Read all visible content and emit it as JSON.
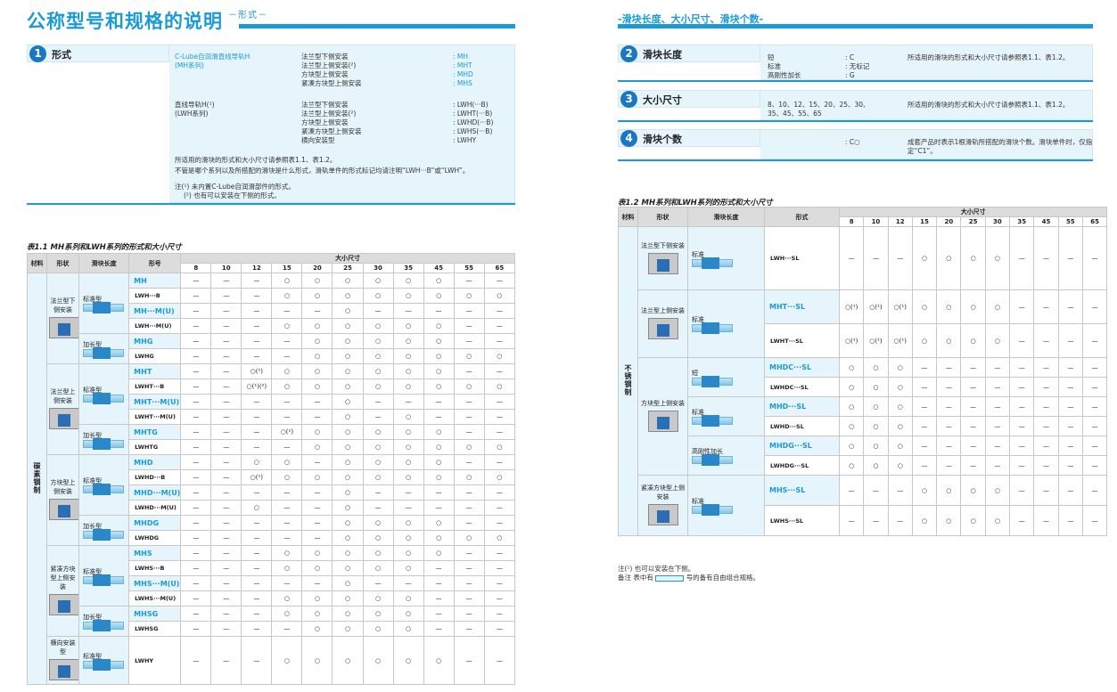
{
  "header": {
    "title": "公称型号和规格的说明",
    "subtitle": "－形式－",
    "right_title": "-滑块长度、大小尺寸、滑块个数-"
  },
  "section1": {
    "num": "1",
    "label": "形式",
    "group1": {
      "name_line1": "C-Lube自润滑直线导轨H",
      "name_line2": "(MH系列)",
      "items": [
        {
          "t": "法兰型下侧安装",
          "c": ": MH"
        },
        {
          "t": "法兰型上侧安装(²)",
          "c": ": MHT"
        },
        {
          "t": "方块型上侧安装",
          "c": ": MHD"
        },
        {
          "t": "紧凑方块型上侧安装",
          "c": ": MHS"
        }
      ]
    },
    "group2": {
      "name_line1": "直线导轨H(¹)",
      "name_line2": "(LWH系列)",
      "items": [
        {
          "t": "法兰型下侧安装",
          "c": ": LWH(···B)"
        },
        {
          "t": "法兰型上侧安装(²)",
          "c": ": LWHT(···B)"
        },
        {
          "t": "方块型上侧安装",
          "c": ": LWHD(···B)"
        },
        {
          "t": "紧凑方块型上侧安装",
          "c": ": LWHS(···B)"
        },
        {
          "t": "横向安装型",
          "c": ": LWHY"
        }
      ]
    },
    "note1": "所适用的滑块的形式和大小尺寸请参照表1.1、表1.2。",
    "note2": "不管是哪个系列以及所搭配的滑块是什么形式，滑轨单件的形式标记均请注明“LWH···B”或“LWH”。",
    "foot1": "注(¹) 未内置C-Lube自润滑部件的形式。",
    "foot2": "(²) 也有可以安装在下侧的形式。"
  },
  "section2": {
    "num": "2",
    "label": "滑块长度",
    "items": [
      {
        "t": "短",
        "c": ": C"
      },
      {
        "t": "标准",
        "c": ": 无标记"
      },
      {
        "t": "高刚性加长",
        "c": ": G"
      }
    ],
    "note": "所适用的滑块的形式和大小尺寸请参照表1.1、表1.2。"
  },
  "section3": {
    "num": "3",
    "label": "大小尺寸",
    "line1": "8、10、12、15、20、25、30、",
    "line2": "35、45、55、65",
    "note": "所适用的滑块的形式和大小尺寸请参照表1.1、表1.2。"
  },
  "section4": {
    "num": "4",
    "label": "滑块个数",
    "code": ": C○",
    "note_line1": "成套产品时表示1根滑轨所搭配的滑块个数。滑块单件时，仅指",
    "note_line2": "定“C1”。"
  },
  "table1": {
    "title": "表1.1  MH系列和LWH系列的形式和大小尺寸",
    "headers": {
      "material": "材料",
      "shape": "形状",
      "length": "滑块长度",
      "model": "形号",
      "size": "大小尺寸"
    },
    "sizes": [
      "8",
      "10",
      "12",
      "15",
      "20",
      "25",
      "30",
      "35",
      "45",
      "55",
      "65"
    ],
    "material": "碳素钢制",
    "groups": [
      {
        "shape": "法兰型下侧安装",
        "lengths": [
          {
            "len": "标准型",
            "rows": [
              {
                "model": "MH",
                "blue": true,
                "v": [
                  "—",
                  "—",
                  "—",
                  "○",
                  "○",
                  "○",
                  "○",
                  "○",
                  "○",
                  "—",
                  "—"
                ]
              },
              {
                "model": "LWH···B",
                "blue": false,
                "v": [
                  "—",
                  "—",
                  "—",
                  "○",
                  "○",
                  "○",
                  "○",
                  "○",
                  "○",
                  "○",
                  "○"
                ]
              },
              {
                "model": "MH···M(U)",
                "blue": true,
                "v": [
                  "—",
                  "—",
                  "—",
                  "—",
                  "—",
                  "○",
                  "—",
                  "—",
                  "—",
                  "—",
                  "—"
                ]
              },
              {
                "model": "LWH···M(U)",
                "blue": false,
                "v": [
                  "—",
                  "—",
                  "—",
                  "○",
                  "○",
                  "○",
                  "○",
                  "○",
                  "○",
                  "—",
                  "—"
                ]
              }
            ]
          },
          {
            "len": "加长型",
            "rows": [
              {
                "model": "MHG",
                "blue": true,
                "v": [
                  "—",
                  "—",
                  "—",
                  "—",
                  "○",
                  "○",
                  "○",
                  "○",
                  "○",
                  "—",
                  "—"
                ]
              },
              {
                "model": "LWHG",
                "blue": false,
                "v": [
                  "—",
                  "—",
                  "—",
                  "—",
                  "○",
                  "○",
                  "○",
                  "○",
                  "○",
                  "○",
                  "○"
                ]
              }
            ]
          }
        ]
      },
      {
        "shape": "法兰型上侧安装",
        "lengths": [
          {
            "len": "标准型",
            "rows": [
              {
                "model": "MHT",
                "blue": true,
                "v": [
                  "—",
                  "—",
                  "○(¹)",
                  "○",
                  "○",
                  "○",
                  "○",
                  "○",
                  "○",
                  "—",
                  "—"
                ]
              },
              {
                "model": "LWHT···B",
                "blue": false,
                "v": [
                  "—",
                  "—",
                  "○(¹)(²)",
                  "○",
                  "○",
                  "○",
                  "○",
                  "○",
                  "○",
                  "○",
                  "○"
                ]
              },
              {
                "model": "MHT···M(U)",
                "blue": true,
                "v": [
                  "—",
                  "—",
                  "—",
                  "—",
                  "—",
                  "○",
                  "—",
                  "—",
                  "—",
                  "—",
                  "—"
                ]
              },
              {
                "model": "LWHT···M(U)",
                "blue": false,
                "v": [
                  "—",
                  "—",
                  "—",
                  "—",
                  "—",
                  "○",
                  "—",
                  "○",
                  "—",
                  "—",
                  "—"
                ]
              }
            ]
          },
          {
            "len": "加长型",
            "rows": [
              {
                "model": "MHTG",
                "blue": true,
                "v": [
                  "—",
                  "—",
                  "—",
                  "○(¹)",
                  "○",
                  "○",
                  "○",
                  "○",
                  "○",
                  "—",
                  "—"
                ]
              },
              {
                "model": "LWHTG",
                "blue": false,
                "v": [
                  "—",
                  "—",
                  "—",
                  "—",
                  "○",
                  "○",
                  "○",
                  "○",
                  "○",
                  "○",
                  "○"
                ]
              }
            ]
          }
        ]
      },
      {
        "shape": "方块型上侧安装",
        "lengths": [
          {
            "len": "标准型",
            "rows": [
              {
                "model": "MHD",
                "blue": true,
                "v": [
                  "—",
                  "—",
                  "○",
                  "○",
                  "—",
                  "○",
                  "○",
                  "○",
                  "○",
                  "—",
                  "—"
                ]
              },
              {
                "model": "LWHD···B",
                "blue": false,
                "v": [
                  "—",
                  "—",
                  "○(¹)",
                  "○",
                  "○",
                  "○",
                  "○",
                  "○",
                  "○",
                  "○",
                  "○"
                ]
              },
              {
                "model": "MHD···M(U)",
                "blue": true,
                "v": [
                  "—",
                  "—",
                  "—",
                  "—",
                  "—",
                  "○",
                  "—",
                  "—",
                  "—",
                  "—",
                  "—"
                ]
              },
              {
                "model": "LWHD···M(U)",
                "blue": false,
                "v": [
                  "—",
                  "—",
                  "○",
                  "—",
                  "—",
                  "○",
                  "—",
                  "—",
                  "—",
                  "—",
                  "—"
                ]
              }
            ]
          },
          {
            "len": "加长型",
            "rows": [
              {
                "model": "MHDG",
                "blue": true,
                "v": [
                  "—",
                  "—",
                  "—",
                  "—",
                  "—",
                  "○",
                  "○",
                  "○",
                  "○",
                  "—",
                  "—"
                ]
              },
              {
                "model": "LWHDG",
                "blue": false,
                "v": [
                  "—",
                  "—",
                  "—",
                  "—",
                  "—",
                  "○",
                  "○",
                  "○",
                  "○",
                  "○",
                  "○"
                ]
              }
            ]
          }
        ]
      },
      {
        "shape": "紧凑方块型上侧安装",
        "lengths": [
          {
            "len": "标准型",
            "rows": [
              {
                "model": "MHS",
                "blue": true,
                "v": [
                  "—",
                  "—",
                  "—",
                  "○",
                  "○",
                  "○",
                  "○",
                  "○",
                  "○",
                  "—",
                  "—"
                ]
              },
              {
                "model": "LWHS···B",
                "blue": false,
                "v": [
                  "—",
                  "—",
                  "—",
                  "○",
                  "○",
                  "○",
                  "○",
                  "○",
                  "—",
                  "—",
                  "—"
                ]
              },
              {
                "model": "MHS···M(U)",
                "blue": true,
                "v": [
                  "—",
                  "—",
                  "—",
                  "—",
                  "—",
                  "○",
                  "—",
                  "—",
                  "—",
                  "—",
                  "—"
                ]
              },
              {
                "model": "LWHS···M(U)",
                "blue": false,
                "v": [
                  "—",
                  "—",
                  "—",
                  "○",
                  "○",
                  "○",
                  "○",
                  "○",
                  "—",
                  "—",
                  "—"
                ]
              }
            ]
          },
          {
            "len": "加长型",
            "rows": [
              {
                "model": "MHSG",
                "blue": true,
                "v": [
                  "—",
                  "—",
                  "—",
                  "○",
                  "○",
                  "○",
                  "○",
                  "○",
                  "—",
                  "—",
                  "—"
                ]
              },
              {
                "model": "LWHSG",
                "blue": false,
                "v": [
                  "—",
                  "—",
                  "—",
                  "—",
                  "○",
                  "○",
                  "○",
                  "○",
                  "—",
                  "—",
                  "—"
                ]
              }
            ]
          }
        ]
      },
      {
        "shape": "横向安装型",
        "lengths": [
          {
            "len": "标准型",
            "rows": [
              {
                "model": "LWHY",
                "blue": false,
                "v": [
                  "—",
                  "—",
                  "—",
                  "○",
                  "○",
                  "○",
                  "○",
                  "○",
                  "○",
                  "—",
                  "—"
                ]
              }
            ]
          }
        ]
      }
    ]
  },
  "table2": {
    "title": "表1.2  MH系列和LWH系列的形式和大小尺寸",
    "material": "不锈钢制",
    "groups": [
      {
        "shape": "法兰型下侧安装",
        "lengths": [
          {
            "len": "标准",
            "rows": [
              {
                "model": "LWH···SL",
                "blue": false,
                "v": [
                  "—",
                  "—",
                  "—",
                  "○",
                  "○",
                  "○",
                  "○",
                  "—",
                  "—",
                  "—",
                  "—"
                ]
              }
            ]
          }
        ]
      },
      {
        "shape": "法兰型上侧安装",
        "lengths": [
          {
            "len": "标准",
            "rows": [
              {
                "model": "MHT···SL",
                "blue": true,
                "v": [
                  "○(¹)",
                  "○(¹)",
                  "○(¹)",
                  "○",
                  "○",
                  "○",
                  "○",
                  "—",
                  "—",
                  "—",
                  "—"
                ]
              },
              {
                "model": "LWHT···SL",
                "blue": false,
                "v": [
                  "○(¹)",
                  "○(¹)",
                  "○(¹)",
                  "○",
                  "○",
                  "○",
                  "○",
                  "—",
                  "—",
                  "—",
                  "—"
                ]
              }
            ]
          }
        ]
      },
      {
        "shape": "方块型上侧安装",
        "lengths": [
          {
            "len": "短",
            "rows": [
              {
                "model": "MHDC···SL",
                "blue": true,
                "v": [
                  "○",
                  "○",
                  "○",
                  "—",
                  "—",
                  "—",
                  "—",
                  "—",
                  "—",
                  "—",
                  "—"
                ]
              },
              {
                "model": "LWHDC···SL",
                "blue": false,
                "v": [
                  "○",
                  "○",
                  "○",
                  "—",
                  "—",
                  "—",
                  "—",
                  "—",
                  "—",
                  "—",
                  "—"
                ]
              }
            ]
          },
          {
            "len": "标准",
            "rows": [
              {
                "model": "MHD···SL",
                "blue": true,
                "v": [
                  "○",
                  "○",
                  "○",
                  "—",
                  "—",
                  "—",
                  "—",
                  "—",
                  "—",
                  "—",
                  "—"
                ]
              },
              {
                "model": "LWHD···SL",
                "blue": false,
                "v": [
                  "○",
                  "○",
                  "○",
                  "—",
                  "—",
                  "—",
                  "—",
                  "—",
                  "—",
                  "—",
                  "—"
                ]
              }
            ]
          },
          {
            "len": "高刚性加长",
            "rows": [
              {
                "model": "MHDG···SL",
                "blue": true,
                "v": [
                  "○",
                  "○",
                  "○",
                  "—",
                  "—",
                  "—",
                  "—",
                  "—",
                  "—",
                  "—",
                  "—"
                ]
              },
              {
                "model": "LWHDG···SL",
                "blue": false,
                "v": [
                  "○",
                  "○",
                  "○",
                  "—",
                  "—",
                  "—",
                  "—",
                  "—",
                  "—",
                  "—",
                  "—"
                ]
              }
            ]
          }
        ]
      },
      {
        "shape": "紧凑方块型上侧安装",
        "lengths": [
          {
            "len": "标准",
            "rows": [
              {
                "model": "MHS···SL",
                "blue": true,
                "v": [
                  "—",
                  "—",
                  "—",
                  "○",
                  "○",
                  "○",
                  "○",
                  "—",
                  "—",
                  "—",
                  "—"
                ]
              },
              {
                "model": "LWHS···SL",
                "blue": false,
                "v": [
                  "—",
                  "—",
                  "—",
                  "○",
                  "○",
                  "○",
                  "○",
                  "—",
                  "—",
                  "—",
                  "—"
                ]
              }
            ]
          }
        ]
      }
    ],
    "foot1": "注(¹)  也可以安装在下侧。",
    "foot2_a": "备注  表中有",
    "foot2_b": "号的备有自由组合规格。"
  }
}
